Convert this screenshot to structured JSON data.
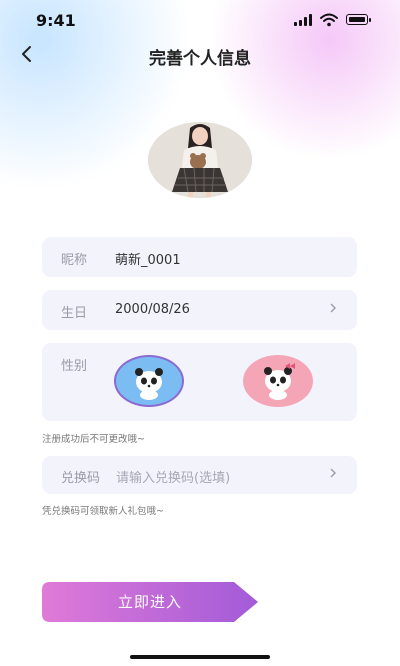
{
  "status_bar": {
    "time": "9:41"
  },
  "header": {
    "title": "完善个人信息"
  },
  "form": {
    "nickname": {
      "label": "昵称",
      "value": "萌新_0001"
    },
    "birthday": {
      "label": "生日",
      "value": "2000/08/26"
    },
    "gender": {
      "label": "性别",
      "male_symbol": "♂",
      "female_symbol": "♀",
      "selected": "male"
    },
    "gender_hint": "注册成功后不可更改哦~",
    "redeem": {
      "label": "兑换码",
      "placeholder": "请输入兑换码(选填)"
    },
    "redeem_hint": "凭兑换码可领取新人礼包哦~"
  },
  "submit": {
    "label": "立即进入"
  },
  "icons": {
    "back": "back-icon",
    "chevron": "chevron-right-icon",
    "signal": "signal-icon",
    "wifi": "wifi-icon",
    "battery": "battery-icon"
  },
  "colors": {
    "cta_start": "#e07ad8",
    "cta_end": "#a25bd8",
    "male": "#7bbdf3",
    "female": "#f4a6b7",
    "card": "#f2f3fb"
  }
}
